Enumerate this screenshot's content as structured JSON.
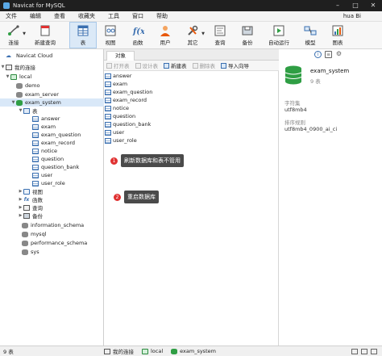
{
  "window": {
    "title": "Navicat for MySQL"
  },
  "menu": {
    "items": [
      "文件",
      "编辑",
      "查看",
      "收藏夹",
      "工具",
      "窗口",
      "帮助"
    ],
    "user": "hua Bi"
  },
  "toolbar": {
    "buttons": [
      {
        "label": "连接",
        "icon": "connection-icon"
      },
      {
        "label": "新建查询",
        "icon": "new-query-icon"
      },
      {
        "label": "表",
        "icon": "table-icon"
      },
      {
        "label": "视图",
        "icon": "view-icon"
      },
      {
        "label": "函数",
        "icon": "function-icon"
      },
      {
        "label": "用户",
        "icon": "user-icon"
      },
      {
        "label": "其它",
        "icon": "tools-icon"
      },
      {
        "label": "查询",
        "icon": "query-icon"
      },
      {
        "label": "备份",
        "icon": "backup-icon"
      },
      {
        "label": "自动运行",
        "icon": "autorun-icon"
      },
      {
        "label": "模型",
        "icon": "model-icon"
      },
      {
        "label": "图表",
        "icon": "chart-icon"
      }
    ],
    "active": "表"
  },
  "tree": {
    "cloud": "Navicat Cloud",
    "group": "我的连接",
    "connection": "local",
    "databases_before": [
      "demo",
      "exam_server"
    ],
    "selected_db": "exam_system",
    "tables_folder": "表",
    "tables": [
      "answer",
      "exam",
      "exam_question",
      "exam_record",
      "notice",
      "question",
      "question_bank",
      "user",
      "user_role"
    ],
    "sub_folders": [
      "视图",
      "函数",
      "查询",
      "备份"
    ],
    "databases_after": [
      "information_schema",
      "mysql",
      "performance_schema",
      "sys"
    ]
  },
  "objects": {
    "tab": "对象",
    "actions": [
      "打开表",
      "设计表",
      "新建表",
      "删除表",
      "导入向导"
    ],
    "tables": [
      "answer",
      "exam",
      "exam_question",
      "exam_record",
      "notice",
      "question",
      "question_bank",
      "user",
      "user_role"
    ]
  },
  "annotations": [
    {
      "num": "1",
      "text": "刷新数据库和表不管用"
    },
    {
      "num": "2",
      "text": "重启数据库"
    }
  ],
  "details": {
    "db_name": "exam_system",
    "table_count": "9 表",
    "charset_label": "字符集",
    "charset": "utf8mb4",
    "collation_label": "排序规则",
    "collation": "utf8mb4_0900_ai_ci"
  },
  "status": {
    "count": "9 表",
    "group": "我的连接",
    "connection": "local",
    "database": "exam_system"
  },
  "colors": {
    "accent": "#3a6fb0",
    "db_green": "#2f9e44",
    "annotation_red": "#e03131"
  }
}
